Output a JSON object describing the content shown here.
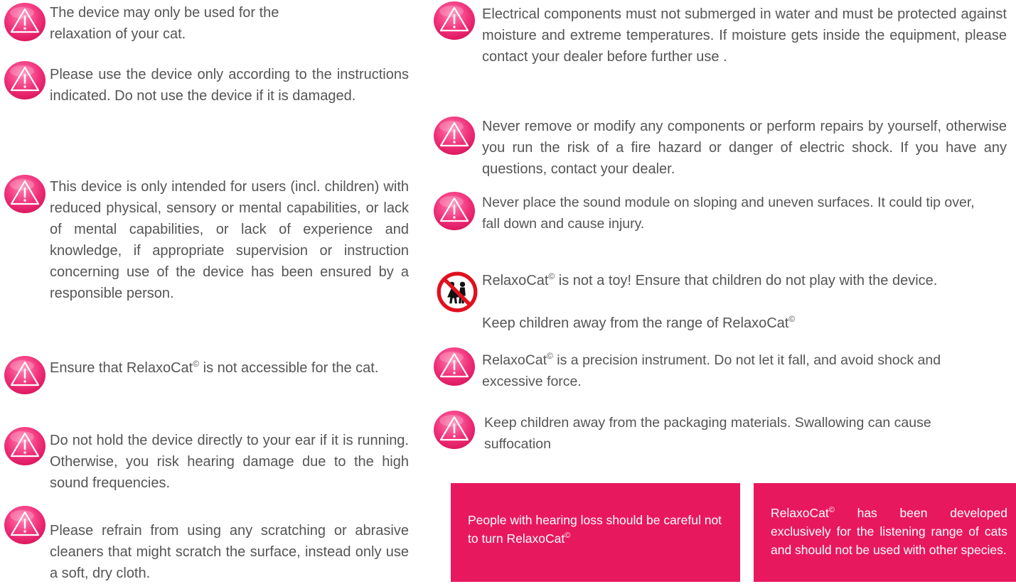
{
  "colors": {
    "accent": "#e8185e",
    "text": "#555555",
    "box_text": "#ffffff"
  },
  "icons": {
    "warning": "warning-triangle-icon",
    "children": "no-children-icon"
  },
  "left_column": {
    "w1": "The device may only be used for the relaxation of your cat.",
    "w2": "Please use the device only according to the instructions indicated. Do not use the device if it is damaged.",
    "w3": "This device is only intended for users (incl. children) with reduced physical, sensory or mental capabilities, or lack of mental capabilities, or lack of experience and knowledge, if appropriate supervision or instruction concerning use of the device has been ensured by a responsible person.",
    "w4a": "Ensure that RelaxoCat",
    "w4b": " is not accessible for the cat.",
    "w5": "Do not hold the device directly to your ear if it is running. Otherwise, you risk hearing damage due to the high sound frequencies.",
    "w6": "Please refrain from using any scratching or abrasive cleaners that might scratch the surface, instead only use a soft, dry cloth."
  },
  "right_column": {
    "r1": "Electrical components must not submerged in water and must be protected against moisture and extreme temperatures. If moisture gets inside the equipment, please contact your dealer before further use .",
    "r2": "Never remove or modify any components or perform repairs by yourself, otherwise you run the risk of a fire hazard or danger of electric shock. If you have any questions, contact your dealer.",
    "r3": "Never place the sound module on sloping and uneven surfaces. It could tip over, fall down and cause injury.",
    "r4a": "RelaxoCat",
    "r4b": " is not a toy! Ensure that children do not play with the device.",
    "r4c": "Keep children away from the range of RelaxoCat",
    "r5a": "RelaxoCat",
    "r5b": " is a precision instrument. Do not let it fall, and avoid shock and excessive force.",
    "r6": "Keep children away from the packaging materials. Swallowing can cause suffocation"
  },
  "copyright_mark": "©",
  "boxes": {
    "left": "People with hearing loss should be careful not to turn RelaxoCat",
    "right_a": "RelaxoCat",
    "right_b": " has been developed exclusively for the listening range of cats and should not be used with other species."
  }
}
